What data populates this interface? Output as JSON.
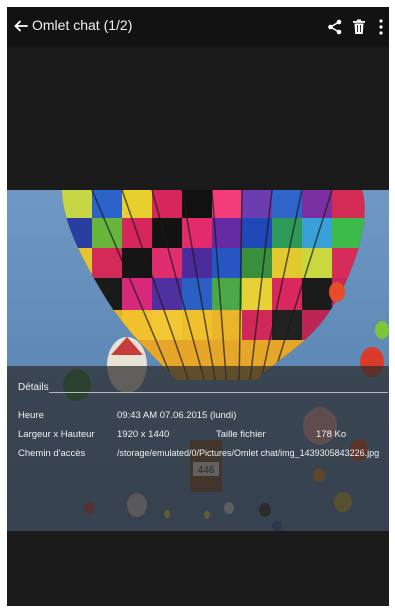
{
  "appbar": {
    "title": "Omlet chat (1/2)",
    "icons": [
      "back-arrow-icon",
      "share-icon",
      "trash-icon",
      "more-vert-icon"
    ]
  },
  "details": {
    "heading": "Détails",
    "time_label": "Heure",
    "time_value": "09:43 AM 07.06.2015 (lundi)",
    "size_label": "Largeur x Hauteur",
    "size_value": "1920 x 1440",
    "filesize_label": "Taille fichier",
    "filesize_value": "178 Ko",
    "path_label": "Chemin d'accès",
    "path_value": "/storage/emulated/0/Pictures/Omlet chat/img_1439305843226.jpg"
  },
  "photo": {
    "basket_number": "446"
  },
  "colors": {
    "app_bar": "#121212",
    "background": "#1b1b1b",
    "sky": "#5b86b3"
  }
}
